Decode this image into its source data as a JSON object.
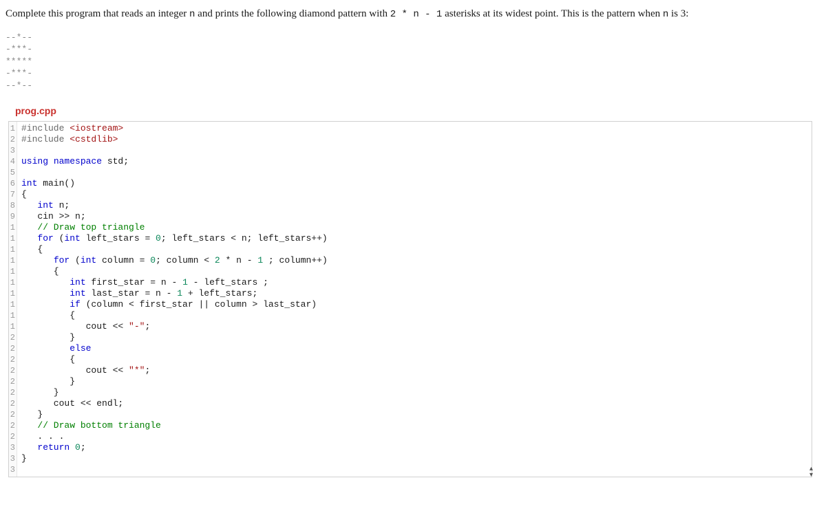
{
  "problem": {
    "prefix": "Complete this program that reads an integer ",
    "var1": "n",
    "mid1": " and prints the following diamond pattern with ",
    "expr": "2 * n - 1",
    "mid2": " asterisks at its widest point. This is the pattern when ",
    "var2": "n",
    "mid3": " is 3:"
  },
  "pattern": "--*--\n-***-\n*****\n-***-\n--*--",
  "filename": "prog.cpp",
  "gutter": "1\n2\n3\n4\n5\n6\n7\n8\n9\n1\n1\n1\n1\n1\n1\n1\n1\n1\n1\n2\n2\n2\n2\n2\n2\n2\n2\n2\n2\n3\n3\n3",
  "code": {
    "l1a": "#include ",
    "l1b": "<iostream>",
    "l2a": "#include ",
    "l2b": "<cstdlib>",
    "l3": "",
    "l4a": "using",
    "l4b": " namespace",
    "l4c": " std;",
    "l5": "",
    "l6a": "int",
    "l6b": " main()",
    "l7": "{",
    "l8a": "   ",
    "l8b": "int",
    "l8c": " n;",
    "l9": "   cin >> n;",
    "l10a": "   ",
    "l10b": "// Draw top triangle",
    "l11a": "   ",
    "l11b": "for",
    "l11c": " (",
    "l11d": "int",
    "l11e": " left_stars = ",
    "l11f": "0",
    "l11g": "; left_stars < n; left_stars++)",
    "l12": "   {",
    "l13a": "      ",
    "l13b": "for",
    "l13c": " (",
    "l13d": "int",
    "l13e": " column = ",
    "l13f": "0",
    "l13g": "; column < ",
    "l13h": "2",
    "l13i": " * n - ",
    "l13j": "1",
    "l13k": " ; column++)",
    "l14": "      {",
    "l15a": "         ",
    "l15b": "int",
    "l15c": " first_star = n - ",
    "l15d": "1",
    "l15e": " - left_stars ;",
    "l16a": "         ",
    "l16b": "int",
    "l16c": " last_star = n - ",
    "l16d": "1",
    "l16e": " + left_stars;",
    "l17a": "         ",
    "l17b": "if",
    "l17c": " (column < first_star || column > last_star)",
    "l18": "         {",
    "l19a": "            cout << ",
    "l19b": "\"-\"",
    "l19c": ";",
    "l20": "         }",
    "l21a": "         ",
    "l21b": "else",
    "l22": "         {",
    "l23a": "            cout << ",
    "l23b": "\"*\"",
    "l23c": ";",
    "l24": "         }",
    "l25": "      }",
    "l26": "      cout << endl;",
    "l27": "   }",
    "l28a": "   ",
    "l28b": "// Draw bottom triangle",
    "l29": "   . . .",
    "l30a": "   ",
    "l30b": "return",
    "l30c": " ",
    "l30d": "0",
    "l30e": ";",
    "l31": "}"
  },
  "arrows": {
    "up": "▴",
    "down": "▾"
  }
}
